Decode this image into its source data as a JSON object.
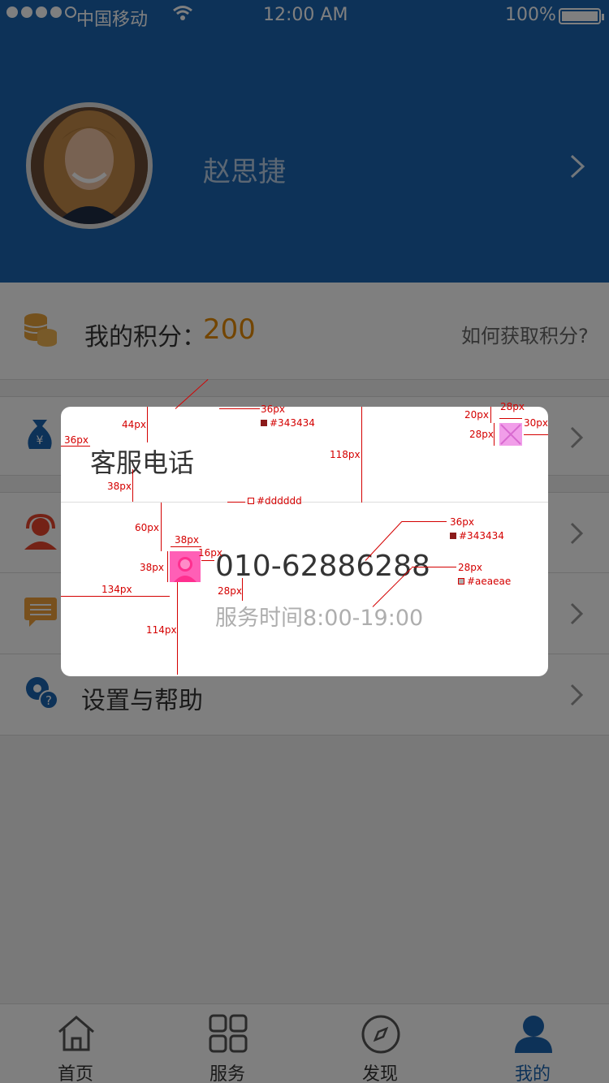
{
  "status_bar": {
    "carrier": "中国移动",
    "time": "12:00 AM",
    "battery": "100%"
  },
  "profile": {
    "name": "赵思捷"
  },
  "points": {
    "label": "我的积分：",
    "value": "200",
    "link": "如何获取积分?"
  },
  "menu": {
    "items": [
      {
        "icon": "money-bag-icon",
        "label": ""
      },
      {
        "icon": "customer-service-icon",
        "label": ""
      },
      {
        "icon": "message-icon",
        "label": ""
      },
      {
        "icon": "settings-help-icon",
        "label": "设置与帮助"
      }
    ]
  },
  "tabs": [
    {
      "label": "首页",
      "icon": "home-icon"
    },
    {
      "label": "服务",
      "icon": "grid-icon"
    },
    {
      "label": "发现",
      "icon": "compass-icon"
    },
    {
      "label": "我的",
      "icon": "user-icon",
      "active": true
    }
  ],
  "dialog": {
    "title": "客服电话",
    "phone": "010-62886288",
    "hours": "服务时间8:00-19:00"
  },
  "annotations": {
    "a1": "36px",
    "a2": "44px",
    "a3": "36px",
    "a4": "#343434",
    "a5": "118px",
    "a6": "20px",
    "a7": "28px",
    "a8": "28px",
    "a9": "30px",
    "a10": "38px",
    "a11": "#dddddd",
    "a12": "60px",
    "a13": "38px",
    "a14": "38px",
    "a15": "16px",
    "a16": "36px",
    "a17": "#343434",
    "a18": "28px",
    "a19": "#aeaeae",
    "a20": "134px",
    "a21": "28px",
    "a22": "114px"
  },
  "colors": {
    "header": "#1b64b1",
    "accent_orange": "#e68a00",
    "text_dark": "#343434",
    "text_gray": "#aeaeae",
    "divider": "#dddddd"
  }
}
